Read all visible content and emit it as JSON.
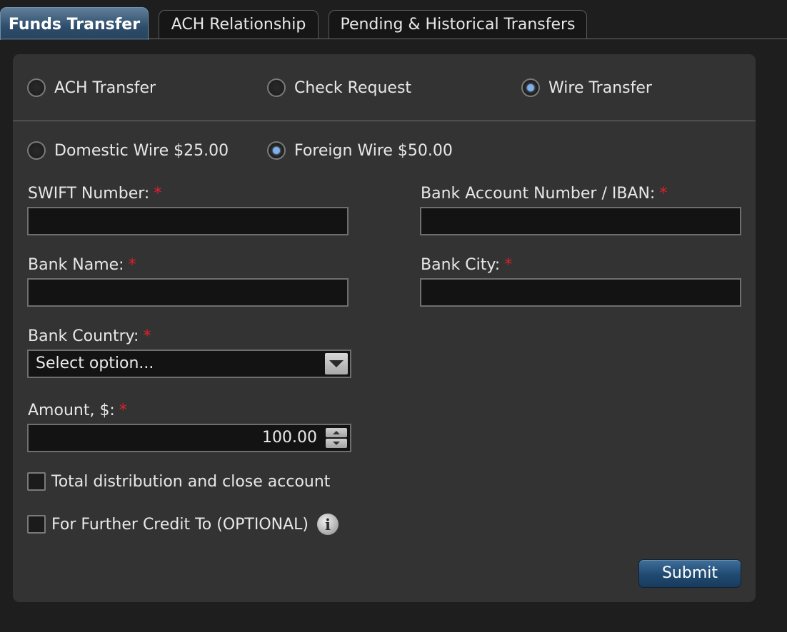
{
  "tabs": [
    {
      "label": "Funds Transfer",
      "active": true
    },
    {
      "label": "ACH Relationship",
      "active": false
    },
    {
      "label": "Pending & Historical Transfers",
      "active": false
    }
  ],
  "transfer_type": {
    "options": [
      {
        "label": "ACH Transfer",
        "selected": false
      },
      {
        "label": "Check Request",
        "selected": false
      },
      {
        "label": "Wire Transfer",
        "selected": true
      }
    ]
  },
  "wire_type": {
    "options": [
      {
        "label": "Domestic Wire $25.00",
        "selected": false
      },
      {
        "label": "Foreign Wire $50.00",
        "selected": true
      }
    ]
  },
  "form": {
    "swift": {
      "label": "SWIFT Number:",
      "value": ""
    },
    "iban": {
      "label": "Bank Account Number / IBAN:",
      "value": ""
    },
    "bank_name": {
      "label": "Bank Name:",
      "value": ""
    },
    "bank_city": {
      "label": "Bank City:",
      "value": ""
    },
    "bank_country": {
      "label": "Bank Country:",
      "selected": "Select option..."
    },
    "amount": {
      "label": "Amount, $:",
      "value": "100.00"
    },
    "required_marker": "*"
  },
  "checkboxes": {
    "total_distribution": {
      "label": "Total distribution and close account",
      "checked": false
    },
    "further_credit": {
      "label": "For Further Credit To (OPTIONAL)",
      "checked": false
    }
  },
  "info_icon_glyph": "i",
  "submit_label": "Submit",
  "colors": {
    "accent": "#2d4d6b",
    "required": "#e0202a",
    "radio_selected": "#7fb0ea"
  }
}
